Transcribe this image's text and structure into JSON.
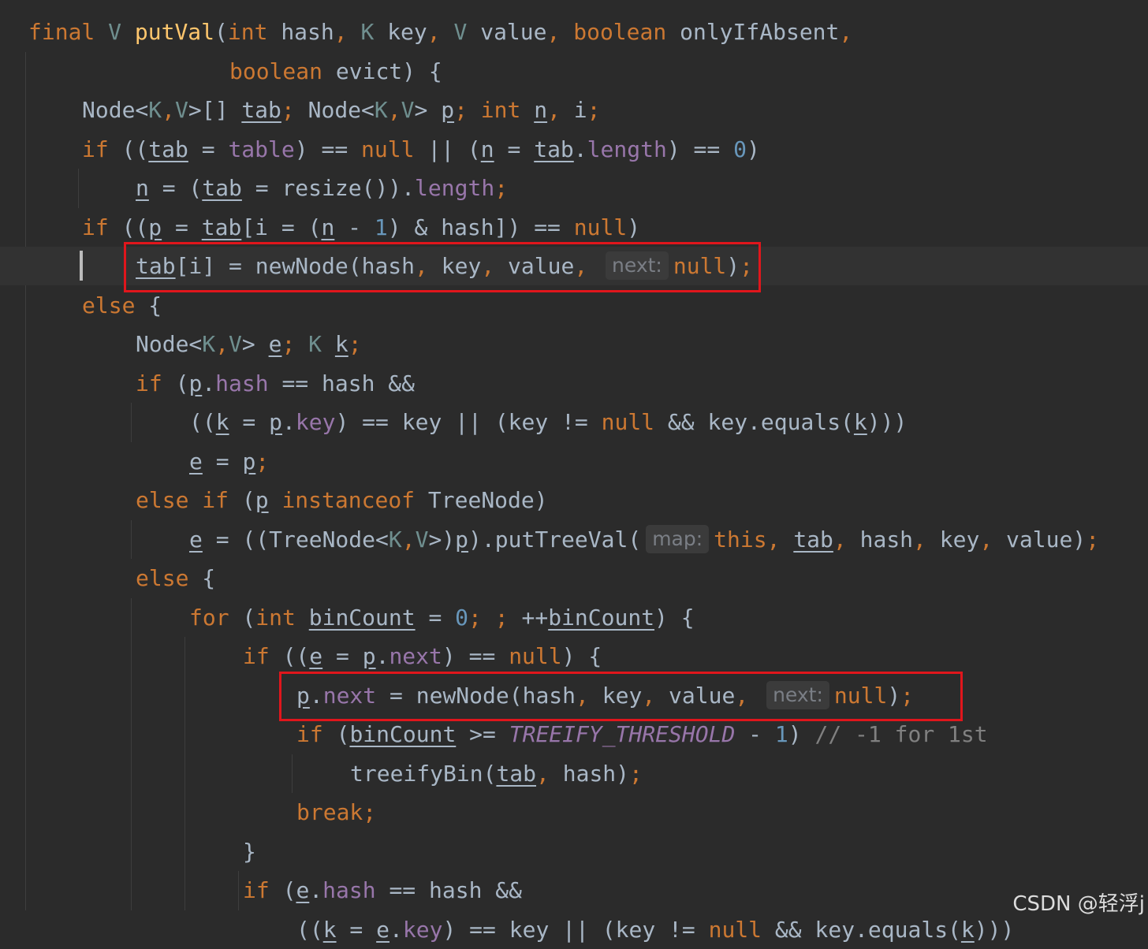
{
  "editor": {
    "colors": {
      "background": "#2b2b2b",
      "keyword": "#cc7832",
      "method": "#ffc66d",
      "field": "#9876aa",
      "number": "#6897bb",
      "highlight_box": "#e0161c"
    },
    "current_line": 6,
    "highlighted_lines": [
      6,
      17
    ],
    "lines": [
      {
        "indent": 0,
        "segments": [
          {
            "t": "final",
            "c": "kw"
          },
          {
            "t": " "
          },
          {
            "t": "V",
            "c": "tp"
          },
          {
            "t": " "
          },
          {
            "t": "putVal",
            "c": "fn"
          },
          {
            "t": "("
          },
          {
            "t": "int",
            "c": "kw"
          },
          {
            "t": " hash"
          },
          {
            "t": ",",
            "c": "kw"
          },
          {
            "t": " "
          },
          {
            "t": "K",
            "c": "tp"
          },
          {
            "t": " key"
          },
          {
            "t": ",",
            "c": "kw"
          },
          {
            "t": " "
          },
          {
            "t": "V",
            "c": "tp"
          },
          {
            "t": " value"
          },
          {
            "t": ",",
            "c": "kw"
          },
          {
            "t": " "
          },
          {
            "t": "boolean",
            "c": "kw"
          },
          {
            "t": " onlyIfAbsent"
          },
          {
            "t": ",",
            "c": "kw"
          }
        ]
      },
      {
        "indent": 15,
        "segments": [
          {
            "t": "boolean",
            "c": "kw"
          },
          {
            "t": " evict) {"
          }
        ]
      },
      {
        "indent": 4,
        "segments": [
          {
            "t": "Node<"
          },
          {
            "t": "K",
            "c": "tp"
          },
          {
            "t": ",",
            "c": "kw"
          },
          {
            "t": "V",
            "c": "tp"
          },
          {
            "t": ">[] "
          },
          {
            "t": "tab",
            "c": "ul"
          },
          {
            "t": ";",
            "c": "kw"
          },
          {
            "t": " Node<"
          },
          {
            "t": "K",
            "c": "tp"
          },
          {
            "t": ",",
            "c": "kw"
          },
          {
            "t": "V",
            "c": "tp"
          },
          {
            "t": "> "
          },
          {
            "t": "p",
            "c": "ul"
          },
          {
            "t": ";",
            "c": "kw"
          },
          {
            "t": " "
          },
          {
            "t": "int",
            "c": "kw"
          },
          {
            "t": " "
          },
          {
            "t": "n",
            "c": "ul"
          },
          {
            "t": ",",
            "c": "kw"
          },
          {
            "t": " i"
          },
          {
            "t": ";",
            "c": "kw"
          }
        ]
      },
      {
        "indent": 4,
        "segments": [
          {
            "t": "if",
            "c": "kw"
          },
          {
            "t": " (("
          },
          {
            "t": "tab",
            "c": "ul"
          },
          {
            "t": " = "
          },
          {
            "t": "table",
            "c": "fd"
          },
          {
            "t": ") == "
          },
          {
            "t": "null",
            "c": "kw"
          },
          {
            "t": " || ("
          },
          {
            "t": "n",
            "c": "ul"
          },
          {
            "t": " = "
          },
          {
            "t": "tab",
            "c": "ul"
          },
          {
            "t": "."
          },
          {
            "t": "length",
            "c": "fd"
          },
          {
            "t": ") == "
          },
          {
            "t": "0",
            "c": "num"
          },
          {
            "t": ")"
          }
        ]
      },
      {
        "indent": 8,
        "segments": [
          {
            "t": "n",
            "c": "ul"
          },
          {
            "t": " = ("
          },
          {
            "t": "tab",
            "c": "ul"
          },
          {
            "t": " = resize())."
          },
          {
            "t": "length",
            "c": "fd"
          },
          {
            "t": ";",
            "c": "kw"
          }
        ]
      },
      {
        "indent": 4,
        "segments": [
          {
            "t": "if",
            "c": "kw"
          },
          {
            "t": " (("
          },
          {
            "t": "p",
            "c": "ul"
          },
          {
            "t": " = "
          },
          {
            "t": "tab",
            "c": "ul"
          },
          {
            "t": "[i = ("
          },
          {
            "t": "n",
            "c": "ul"
          },
          {
            "t": " - "
          },
          {
            "t": "1",
            "c": "num"
          },
          {
            "t": ") & hash]) == "
          },
          {
            "t": "null",
            "c": "kw"
          },
          {
            "t": ")"
          }
        ]
      },
      {
        "indent": 8,
        "segments": [
          {
            "t": "tab",
            "c": "ul"
          },
          {
            "t": "[i] = newNode(hash"
          },
          {
            "t": ",",
            "c": "kw"
          },
          {
            "t": " key"
          },
          {
            "t": ",",
            "c": "kw"
          },
          {
            "t": " value"
          },
          {
            "t": ",",
            "c": "kw"
          },
          {
            "t": " "
          },
          {
            "t": "next:",
            "c": "hint"
          },
          {
            "t": "null",
            "c": "kw"
          },
          {
            "t": ")"
          },
          {
            "t": ";",
            "c": "kw"
          }
        ]
      },
      {
        "indent": 4,
        "segments": [
          {
            "t": "else",
            "c": "kw"
          },
          {
            "t": " {"
          }
        ]
      },
      {
        "indent": 8,
        "segments": [
          {
            "t": "Node<"
          },
          {
            "t": "K",
            "c": "tp"
          },
          {
            "t": ",",
            "c": "kw"
          },
          {
            "t": "V",
            "c": "tp"
          },
          {
            "t": "> "
          },
          {
            "t": "e",
            "c": "ul"
          },
          {
            "t": ";",
            "c": "kw"
          },
          {
            "t": " "
          },
          {
            "t": "K",
            "c": "tp"
          },
          {
            "t": " "
          },
          {
            "t": "k",
            "c": "ul"
          },
          {
            "t": ";",
            "c": "kw"
          }
        ]
      },
      {
        "indent": 8,
        "segments": [
          {
            "t": "if",
            "c": "kw"
          },
          {
            "t": " ("
          },
          {
            "t": "p",
            "c": "ul"
          },
          {
            "t": "."
          },
          {
            "t": "hash",
            "c": "fd"
          },
          {
            "t": " == hash &&"
          }
        ]
      },
      {
        "indent": 12,
        "segments": [
          {
            "t": "(("
          },
          {
            "t": "k",
            "c": "ul"
          },
          {
            "t": " = "
          },
          {
            "t": "p",
            "c": "ul"
          },
          {
            "t": "."
          },
          {
            "t": "key",
            "c": "fd"
          },
          {
            "t": ") == key || (key != "
          },
          {
            "t": "null",
            "c": "kw"
          },
          {
            "t": " && key.equals("
          },
          {
            "t": "k",
            "c": "ul"
          },
          {
            "t": ")))"
          }
        ]
      },
      {
        "indent": 12,
        "segments": [
          {
            "t": "e",
            "c": "ul"
          },
          {
            "t": " = "
          },
          {
            "t": "p",
            "c": "ul"
          },
          {
            "t": ";",
            "c": "kw"
          }
        ]
      },
      {
        "indent": 8,
        "segments": [
          {
            "t": "else if",
            "c": "kw"
          },
          {
            "t": " ("
          },
          {
            "t": "p",
            "c": "ul"
          },
          {
            "t": " "
          },
          {
            "t": "instanceof",
            "c": "kw"
          },
          {
            "t": " TreeNode)"
          }
        ]
      },
      {
        "indent": 12,
        "segments": [
          {
            "t": "e",
            "c": "ul"
          },
          {
            "t": " = ((TreeNode<"
          },
          {
            "t": "K",
            "c": "tp"
          },
          {
            "t": ",",
            "c": "kw"
          },
          {
            "t": "V",
            "c": "tp"
          },
          {
            "t": ">)"
          },
          {
            "t": "p",
            "c": "ul"
          },
          {
            "t": ").putTreeVal("
          },
          {
            "t": "map:",
            "c": "hint"
          },
          {
            "t": "this",
            "c": "kw"
          },
          {
            "t": ",",
            "c": "kw"
          },
          {
            "t": " "
          },
          {
            "t": "tab",
            "c": "ul"
          },
          {
            "t": ",",
            "c": "kw"
          },
          {
            "t": " hash"
          },
          {
            "t": ",",
            "c": "kw"
          },
          {
            "t": " key"
          },
          {
            "t": ",",
            "c": "kw"
          },
          {
            "t": " value)"
          },
          {
            "t": ";",
            "c": "kw"
          }
        ]
      },
      {
        "indent": 8,
        "segments": [
          {
            "t": "else",
            "c": "kw"
          },
          {
            "t": " {"
          }
        ]
      },
      {
        "indent": 12,
        "segments": [
          {
            "t": "for",
            "c": "kw"
          },
          {
            "t": " ("
          },
          {
            "t": "int",
            "c": "kw"
          },
          {
            "t": " "
          },
          {
            "t": "binCount",
            "c": "ul"
          },
          {
            "t": " = "
          },
          {
            "t": "0",
            "c": "num"
          },
          {
            "t": ";",
            "c": "kw"
          },
          {
            "t": " "
          },
          {
            "t": ";",
            "c": "kw"
          },
          {
            "t": " ++"
          },
          {
            "t": "binCount",
            "c": "ul"
          },
          {
            "t": ") {"
          }
        ]
      },
      {
        "indent": 16,
        "segments": [
          {
            "t": "if",
            "c": "kw"
          },
          {
            "t": " (("
          },
          {
            "t": "e",
            "c": "ul"
          },
          {
            "t": " = "
          },
          {
            "t": "p",
            "c": "ul"
          },
          {
            "t": "."
          },
          {
            "t": "next",
            "c": "fd"
          },
          {
            "t": ") == "
          },
          {
            "t": "null",
            "c": "kw"
          },
          {
            "t": ") {"
          }
        ]
      },
      {
        "indent": 20,
        "segments": [
          {
            "t": "p",
            "c": "ul"
          },
          {
            "t": "."
          },
          {
            "t": "next",
            "c": "fd"
          },
          {
            "t": " = newNode(hash"
          },
          {
            "t": ",",
            "c": "kw"
          },
          {
            "t": " key"
          },
          {
            "t": ",",
            "c": "kw"
          },
          {
            "t": " value"
          },
          {
            "t": ",",
            "c": "kw"
          },
          {
            "t": " "
          },
          {
            "t": "next:",
            "c": "hint"
          },
          {
            "t": "null",
            "c": "kw"
          },
          {
            "t": ")"
          },
          {
            "t": ";",
            "c": "kw"
          }
        ]
      },
      {
        "indent": 20,
        "segments": [
          {
            "t": "if",
            "c": "kw"
          },
          {
            "t": " ("
          },
          {
            "t": "binCount",
            "c": "ul"
          },
          {
            "t": " >= "
          },
          {
            "t": "TREEIFY_THRESHOLD",
            "c": "cst"
          },
          {
            "t": " - "
          },
          {
            "t": "1",
            "c": "num"
          },
          {
            "t": ") "
          },
          {
            "t": "// -1 for 1st",
            "c": "cm"
          }
        ]
      },
      {
        "indent": 24,
        "segments": [
          {
            "t": "treeifyBin("
          },
          {
            "t": "tab",
            "c": "ul"
          },
          {
            "t": ",",
            "c": "kw"
          },
          {
            "t": " hash)"
          },
          {
            "t": ";",
            "c": "kw"
          }
        ]
      },
      {
        "indent": 20,
        "segments": [
          {
            "t": "break",
            "c": "kw"
          },
          {
            "t": ";",
            "c": "kw"
          }
        ]
      },
      {
        "indent": 16,
        "segments": [
          {
            "t": "}"
          }
        ]
      },
      {
        "indent": 16,
        "segments": [
          {
            "t": "if",
            "c": "kw"
          },
          {
            "t": " ("
          },
          {
            "t": "e",
            "c": "ul"
          },
          {
            "t": "."
          },
          {
            "t": "hash",
            "c": "fd"
          },
          {
            "t": " == hash &&"
          }
        ]
      },
      {
        "indent": 20,
        "segments": [
          {
            "t": "(("
          },
          {
            "t": "k",
            "c": "ul"
          },
          {
            "t": " = "
          },
          {
            "t": "e",
            "c": "ul"
          },
          {
            "t": "."
          },
          {
            "t": "key",
            "c": "fd"
          },
          {
            "t": ") == key || (key != "
          },
          {
            "t": "null",
            "c": "kw"
          },
          {
            "t": " && key.equals("
          },
          {
            "t": "k",
            "c": "ul"
          },
          {
            "t": ")))"
          }
        ]
      }
    ]
  },
  "watermark": "CSDN @轻浮j"
}
